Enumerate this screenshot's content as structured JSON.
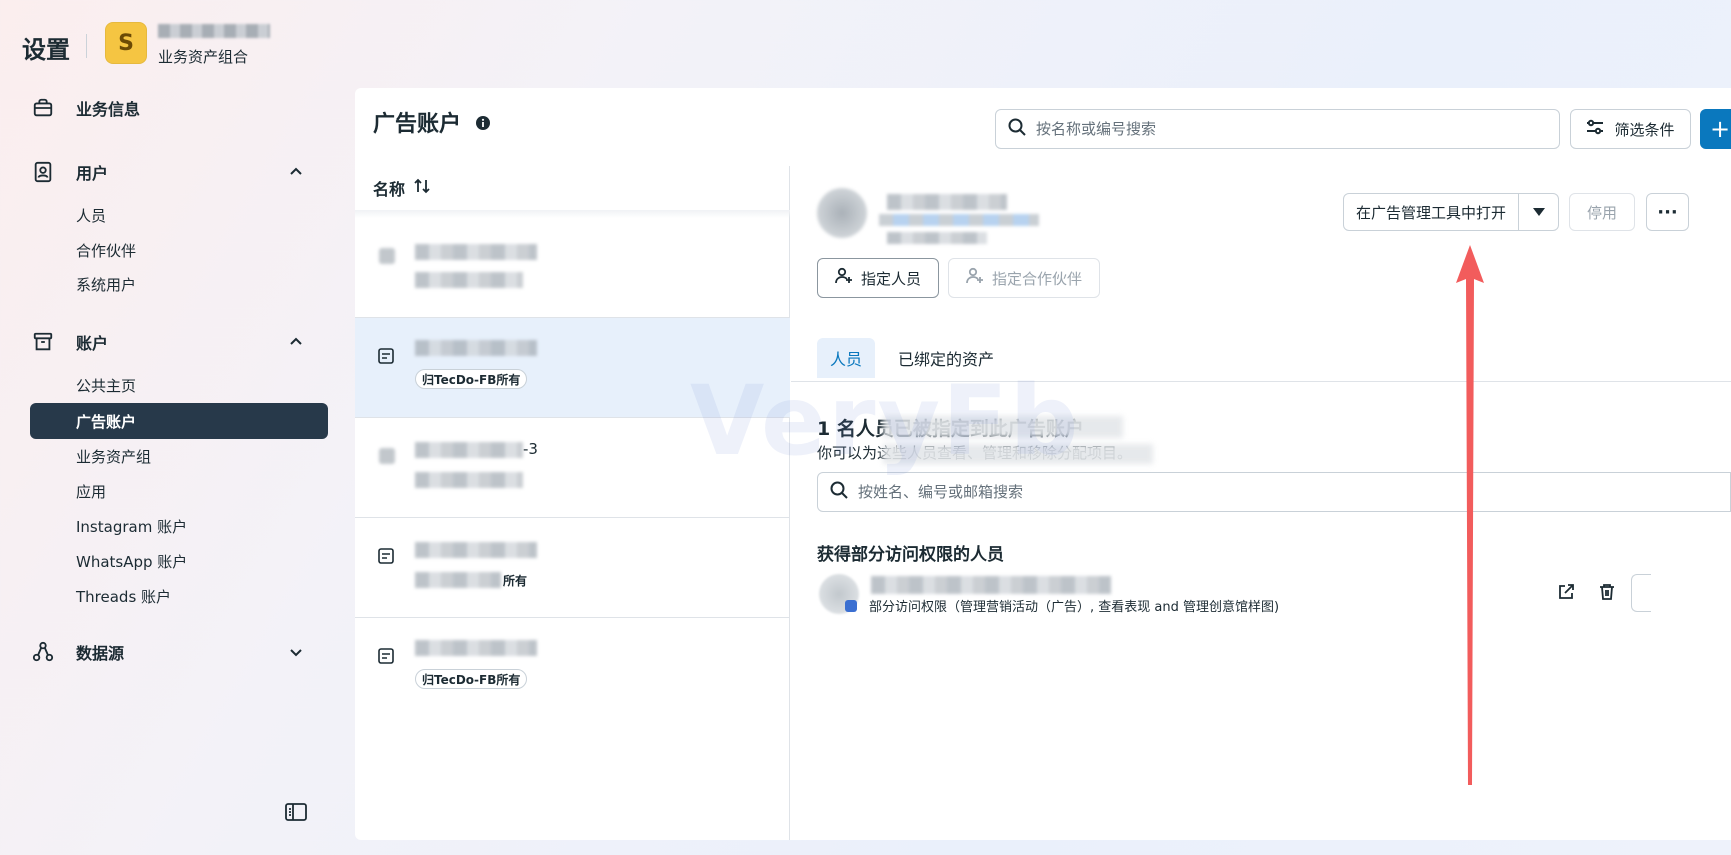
{
  "header": {
    "app_title": "设置",
    "portfolio_logo_letter": "S",
    "portfolio_subtitle": "业务资产组合"
  },
  "sidebar": {
    "groups": [
      {
        "label": "业务信息",
        "icon": "briefcase-icon"
      },
      {
        "label": "用户",
        "icon": "user-badge-icon",
        "expanded": true
      },
      {
        "label": "账户",
        "icon": "archive-box-icon",
        "expanded": true
      },
      {
        "label": "数据源",
        "icon": "data-source-icon",
        "expanded": false
      }
    ],
    "users_items": [
      "人员",
      "合作伙伴",
      "系统用户"
    ],
    "accounts_items": [
      "公共主页",
      "广告账户",
      "业务资产组",
      "应用",
      "Instagram 账户",
      "WhatsApp 账户",
      "Threads 账户"
    ],
    "active_item": "广告账户"
  },
  "main": {
    "title": "广告账户",
    "search_placeholder": "按名称或编号搜索",
    "filter_label": "筛选条件",
    "add_label": "+"
  },
  "list": {
    "header": "名称",
    "rows": [
      {
        "tail": "",
        "badge": ""
      },
      {
        "tail": "",
        "badge": "归TecDo-FB所有",
        "selected": true
      },
      {
        "tail": "-3",
        "badge": ""
      },
      {
        "tail": "",
        "badge": "",
        "badge_fragment": "所有"
      },
      {
        "tail": "",
        "badge": "归TecDo-FB所有"
      }
    ]
  },
  "detail": {
    "open_in_manager_label": "在广告管理工具中打开",
    "disable_label": "停用",
    "more_label": "···",
    "assign_people_label": "指定人员",
    "assign_partner_label": "指定合作伙伴",
    "tabs": [
      "人员",
      "已绑定的资产"
    ],
    "summary_title": "1 名人员已被指定到此广告账户",
    "summary_desc": "你可以为这些人员查看、管理和移除分配项目。",
    "people_search_placeholder": "按姓名、编号或邮箱搜索",
    "section_title": "获得部分访问权限的人员",
    "person_access": "部分访问权限（管理营销活动（广告）, 查看表现 and 管理创意馆样图)"
  },
  "watermark": "VeryFb",
  "colors": {
    "active_nav_bg": "#27394a",
    "primary_blue": "#0a78be",
    "annotation_arrow": "#f25c5c"
  }
}
